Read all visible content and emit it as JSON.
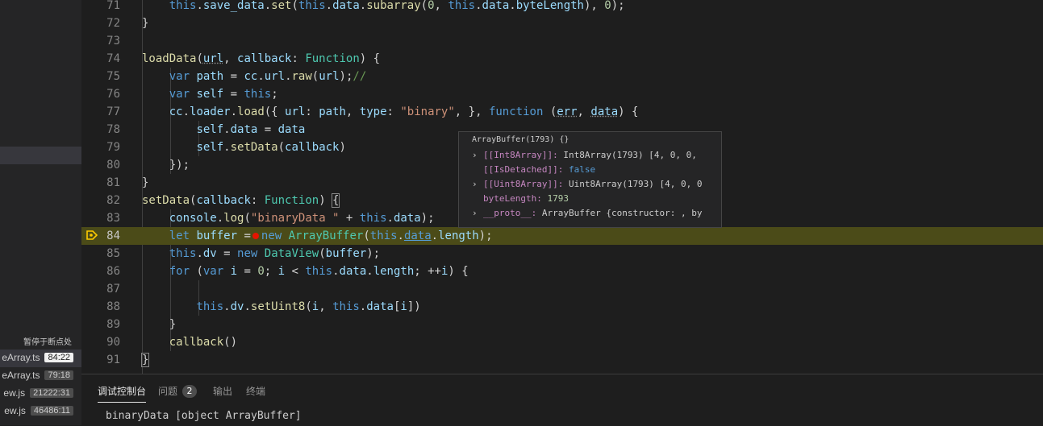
{
  "callstack": {
    "paused_label": "暂停于断点处",
    "frames": [
      {
        "file": "eArray.ts",
        "pos": "84:22",
        "active": true
      },
      {
        "file": "eArray.ts",
        "pos": "79:18",
        "active": false
      },
      {
        "file": "ew.js",
        "pos": "21222:31",
        "active": false
      },
      {
        "file": "ew.js",
        "pos": "46486:11",
        "active": false
      }
    ]
  },
  "editor": {
    "current_line": "84",
    "line_numbers": [
      "71",
      "72",
      "73",
      "74",
      "75",
      "76",
      "77",
      "78",
      "79",
      "80",
      "81",
      "82",
      "83",
      "84",
      "85",
      "86",
      "87",
      "88",
      "89",
      "90",
      "91"
    ]
  },
  "hover": {
    "header": "ArrayBuffer(1793) {}",
    "rows": [
      {
        "key": "[[Int8Array]]:",
        "value": "Int8Array(1793) [4, 0, 0,",
        "expandable": true
      },
      {
        "key": "[[IsDetached]]:",
        "value": "false",
        "expandable": false
      },
      {
        "key": "[[Uint8Array]]:",
        "value": "Uint8Array(1793) [4, 0, 0",
        "expandable": true
      },
      {
        "key": "byteLength:",
        "value": "1793",
        "expandable": false
      },
      {
        "key": "__proto__:",
        "value": "ArrayBuffer {constructor: , by",
        "expandable": true
      }
    ]
  },
  "panel": {
    "tabs": [
      {
        "label": "调试控制台",
        "active": true
      },
      {
        "label": "问题",
        "count": "2",
        "active": false
      },
      {
        "label": "输出",
        "active": false
      },
      {
        "label": "终端",
        "active": false
      }
    ],
    "output": "binaryData [object ArrayBuffer]"
  }
}
